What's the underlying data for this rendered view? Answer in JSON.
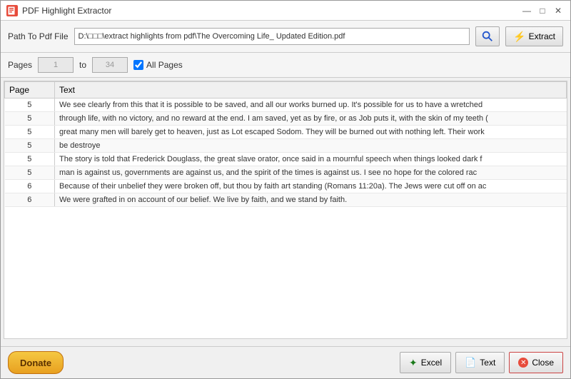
{
  "window": {
    "title": "PDF Highlight Extractor",
    "icon_label": "PDF"
  },
  "title_controls": {
    "minimize": "—",
    "maximize": "□",
    "close": "✕"
  },
  "toolbar": {
    "path_label": "Path To Pdf File",
    "path_value": "D:\\□□□\\extract highlights from pdf\\The Overcoming Life_ Updated Edition.pdf",
    "search_btn_label": "Search",
    "extract_btn_label": "Extract"
  },
  "pages": {
    "label": "Pages",
    "from": "1",
    "to_label": "to",
    "to": "34",
    "all_pages_label": "All Pages",
    "all_pages_checked": true
  },
  "table": {
    "col_page": "Page",
    "col_text": "Text",
    "rows": [
      {
        "page": "5",
        "text": "We see clearly from this that it is possible to be saved, and all our works burned up. It's possible for us to have a wretched"
      },
      {
        "page": "5",
        "text": "through life, with no victory, and no reward at the end. I am saved, yet as by fire, or as Job puts it, with the skin of my teeth ("
      },
      {
        "page": "5",
        "text": "great many men will barely get to heaven, just as Lot escaped Sodom. They will be burned out with nothing left. Their work"
      },
      {
        "page": "5",
        "text": "be destroye"
      },
      {
        "page": "5",
        "text": "The story is told that Frederick Douglass, the great slave orator, once said in a mournful speech when things looked dark f"
      },
      {
        "page": "5",
        "text": "man is against us, governments are against us, and the spirit of the times is against us. I see no hope for the colored rac"
      },
      {
        "page": "6",
        "text": "Because of their unbelief they were broken off, but thou by faith art standing (Romans 11:20a). The Jews were cut off on ac"
      },
      {
        "page": "6",
        "text": "We were grafted in on account of our belief. We live by faith, and we stand by faith."
      }
    ]
  },
  "bottom": {
    "donate_label": "Donate",
    "excel_label": "Excel",
    "text_label": "Text",
    "close_label": "Close"
  }
}
